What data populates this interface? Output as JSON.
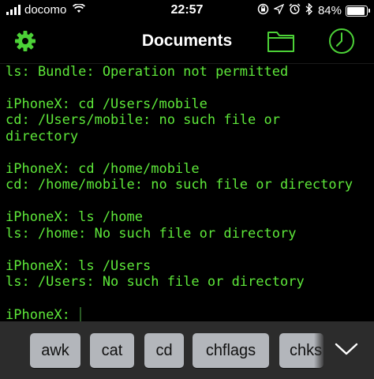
{
  "status_bar": {
    "carrier": "docomo",
    "time": "22:57",
    "battery_percent": "84%",
    "battery_level": 0.84,
    "icons": [
      "signal-bars-icon",
      "wifi-icon",
      "orientation-lock-icon",
      "location-arrow-icon",
      "alarm-icon",
      "bluetooth-icon",
      "battery-icon"
    ]
  },
  "nav_bar": {
    "title": "Documents",
    "left_icon": "gear-icon",
    "right_icons": [
      "folder-icon",
      "clock-icon"
    ]
  },
  "terminal": {
    "lines": [
      "ls: Bundle: Operation not permitted",
      "",
      "iPhoneX: cd /Users/mobile",
      "cd: /Users/mobile: no such file or",
      "directory",
      "",
      "iPhoneX: cd /home/mobile",
      "cd: /home/mobile: no such file or directory",
      "",
      "iPhoneX: ls /home",
      "ls: /home: No such file or directory",
      "",
      "iPhoneX: ls /Users",
      "ls: /Users: No such file or directory",
      "",
      "iPhoneX: "
    ],
    "text_color": "#5ee83a"
  },
  "keyboard_toolbar": {
    "keys": [
      "awk",
      "cat",
      "cd",
      "chflags",
      "chks"
    ],
    "dismiss_icon": "chevron-down-icon"
  },
  "colors": {
    "accent_green": "#4cd137",
    "terminal_green": "#5ee83a",
    "toolbar_bg": "#2c2c2c",
    "key_bg": "#b3b6bb"
  }
}
